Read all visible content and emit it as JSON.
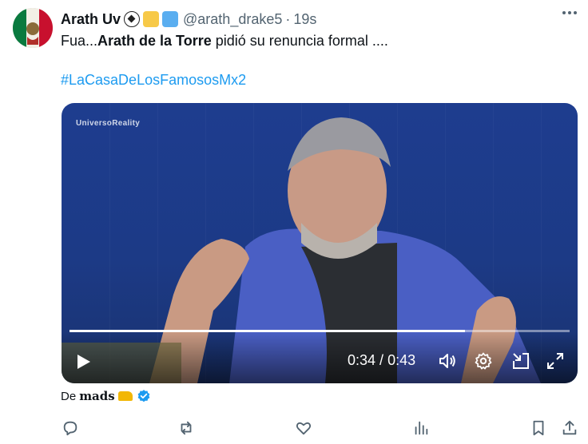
{
  "author": {
    "display_name": "Arath Uv",
    "handle": "@arath_drake5",
    "separator": "·",
    "time_ago": "19s"
  },
  "tweet": {
    "text_start": "Fua...",
    "text_bold": "Arath de la Torre",
    "text_end": " pidió su renuncia formal ....",
    "hashtag": "#LaCasaDeLosFamososMx2"
  },
  "video": {
    "watermark": "UniversoReality",
    "current_time": "0:34",
    "time_separator": " / ",
    "duration": "0:43",
    "progress": 0.79
  },
  "source": {
    "prefix": "De",
    "author": "mads"
  },
  "colors": {
    "accent": "#1d9bf0",
    "text_primary": "#0f1419",
    "text_secondary": "#536471"
  },
  "icons": {
    "more": "more-horizontal-icon",
    "play": "play-icon",
    "volume": "volume-icon",
    "settings": "gear-icon",
    "pip": "picture-in-picture-icon",
    "fullscreen": "fullscreen-icon",
    "reply": "reply-icon",
    "retweet": "retweet-icon",
    "like": "heart-icon",
    "views": "views-icon",
    "bookmark": "bookmark-icon",
    "share": "share-icon"
  }
}
